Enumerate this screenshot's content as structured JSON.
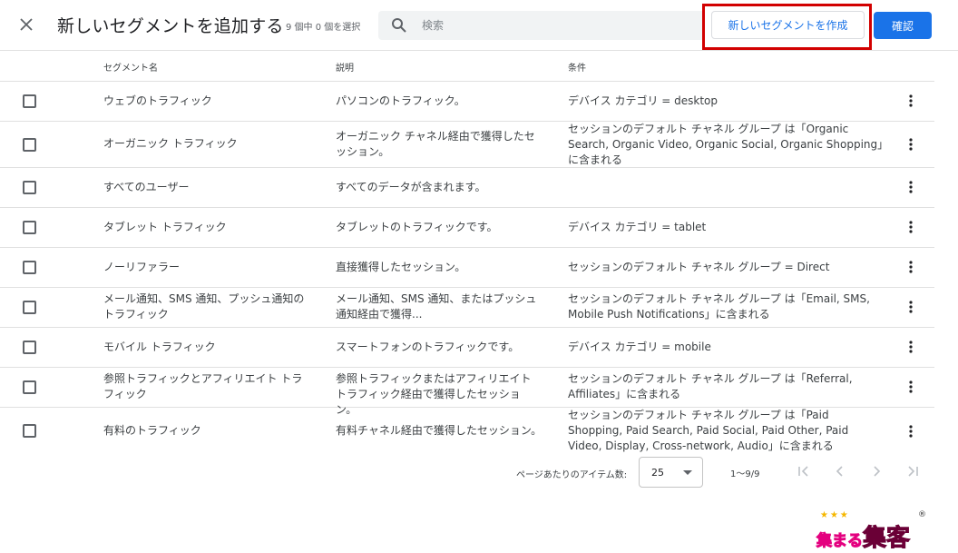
{
  "header": {
    "title": "新しいセグメントを追加する",
    "selected_count": "9 個中 0 個を選択",
    "search_placeholder": "検索",
    "new_segment_button": "新しいセグメントを作成",
    "confirm_button": "確認"
  },
  "columns": [
    "セグメント名",
    "説明",
    "条件"
  ],
  "rows": [
    {
      "name": "ウェブのトラフィック",
      "description": "パソコンのトラフィック。",
      "condition": "デバイス カテゴリ = desktop"
    },
    {
      "name": "オーガニック トラフィック",
      "description": "オーガニック チャネル経由で獲得したセッション。",
      "condition": "セッションのデフォルト チャネル グループ は「Organic Search, Organic Video, Organic Social, Organic Shopping」に含まれる"
    },
    {
      "name": "すべてのユーザー",
      "description": "すべてのデータが含まれます。",
      "condition": ""
    },
    {
      "name": "タブレット トラフィック",
      "description": "タブレットのトラフィックです。",
      "condition": "デバイス カテゴリ = tablet"
    },
    {
      "name": "ノーリファラー",
      "description": "直接獲得したセッション。",
      "condition": "セッションのデフォルト チャネル グループ = Direct"
    },
    {
      "name": "メール通知、SMS 通知、プッシュ通知のトラフィック",
      "description": "メール通知、SMS 通知、またはプッシュ通知経由で獲得...",
      "condition": "セッションのデフォルト チャネル グループ は「Email, SMS, Mobile Push Notifications」に含まれる"
    },
    {
      "name": "モバイル トラフィック",
      "description": "スマートフォンのトラフィックです。",
      "condition": "デバイス カテゴリ = mobile"
    },
    {
      "name": "参照トラフィックとアフィリエイト トラフィック",
      "description": "参照トラフィックまたはアフィリエイト トラフィック経由で獲得したセッション。",
      "condition": "セッションのデフォルト チャネル グループ は「Referral, Affiliates」に含まれる"
    },
    {
      "name": "有料のトラフィック",
      "description": "有料チャネル経由で獲得したセッション。",
      "condition": "セッションのデフォルト チャネル グループ は「Paid Shopping, Paid Search, Paid Social, Paid Other, Paid Video, Display, Cross-network, Audio」に含まれる"
    }
  ],
  "pagination": {
    "items_per_page_label": "ページあたりのアイテム数:",
    "items_per_page_value": "25",
    "range": "1〜9/9"
  },
  "watermark": {
    "text_small": "集まる",
    "text_big": "集客",
    "mark": "®"
  },
  "colors": {
    "accent": "#1a73e8",
    "highlight_border": "#d20000",
    "logo_pink": "#e4007f",
    "logo_yellow": "#ffd400"
  }
}
